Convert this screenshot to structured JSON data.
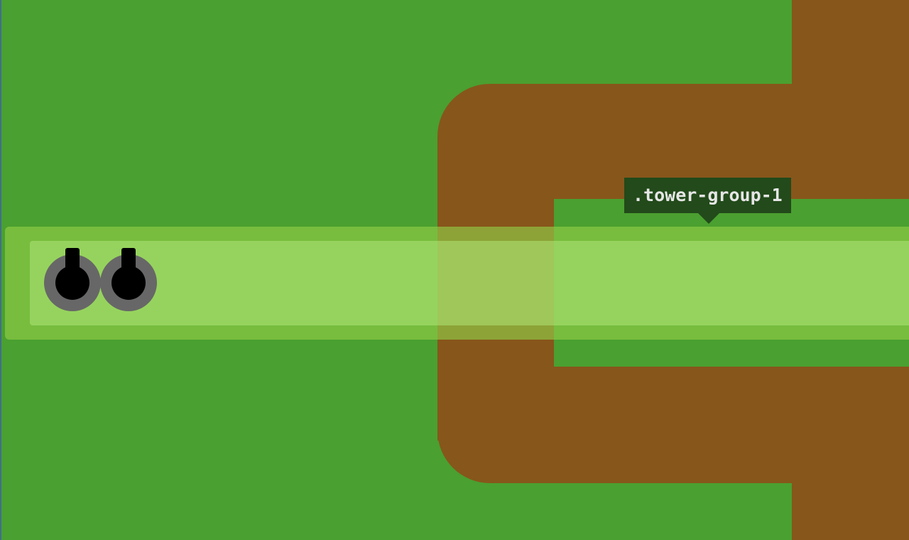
{
  "tooltip": {
    "label": ".tower-group-1"
  },
  "tower_group": {
    "towers": [
      {
        "icon": "tower-icon"
      },
      {
        "icon": "tower-icon"
      }
    ]
  },
  "colors": {
    "grass": "#4aa030",
    "path": "#87561b",
    "tower_group_highlight": "#91cd46",
    "tower_base": "#676767",
    "tower_core": "#000000",
    "tooltip_background": "#224a1a",
    "tooltip_text": "#e6e6e6"
  }
}
